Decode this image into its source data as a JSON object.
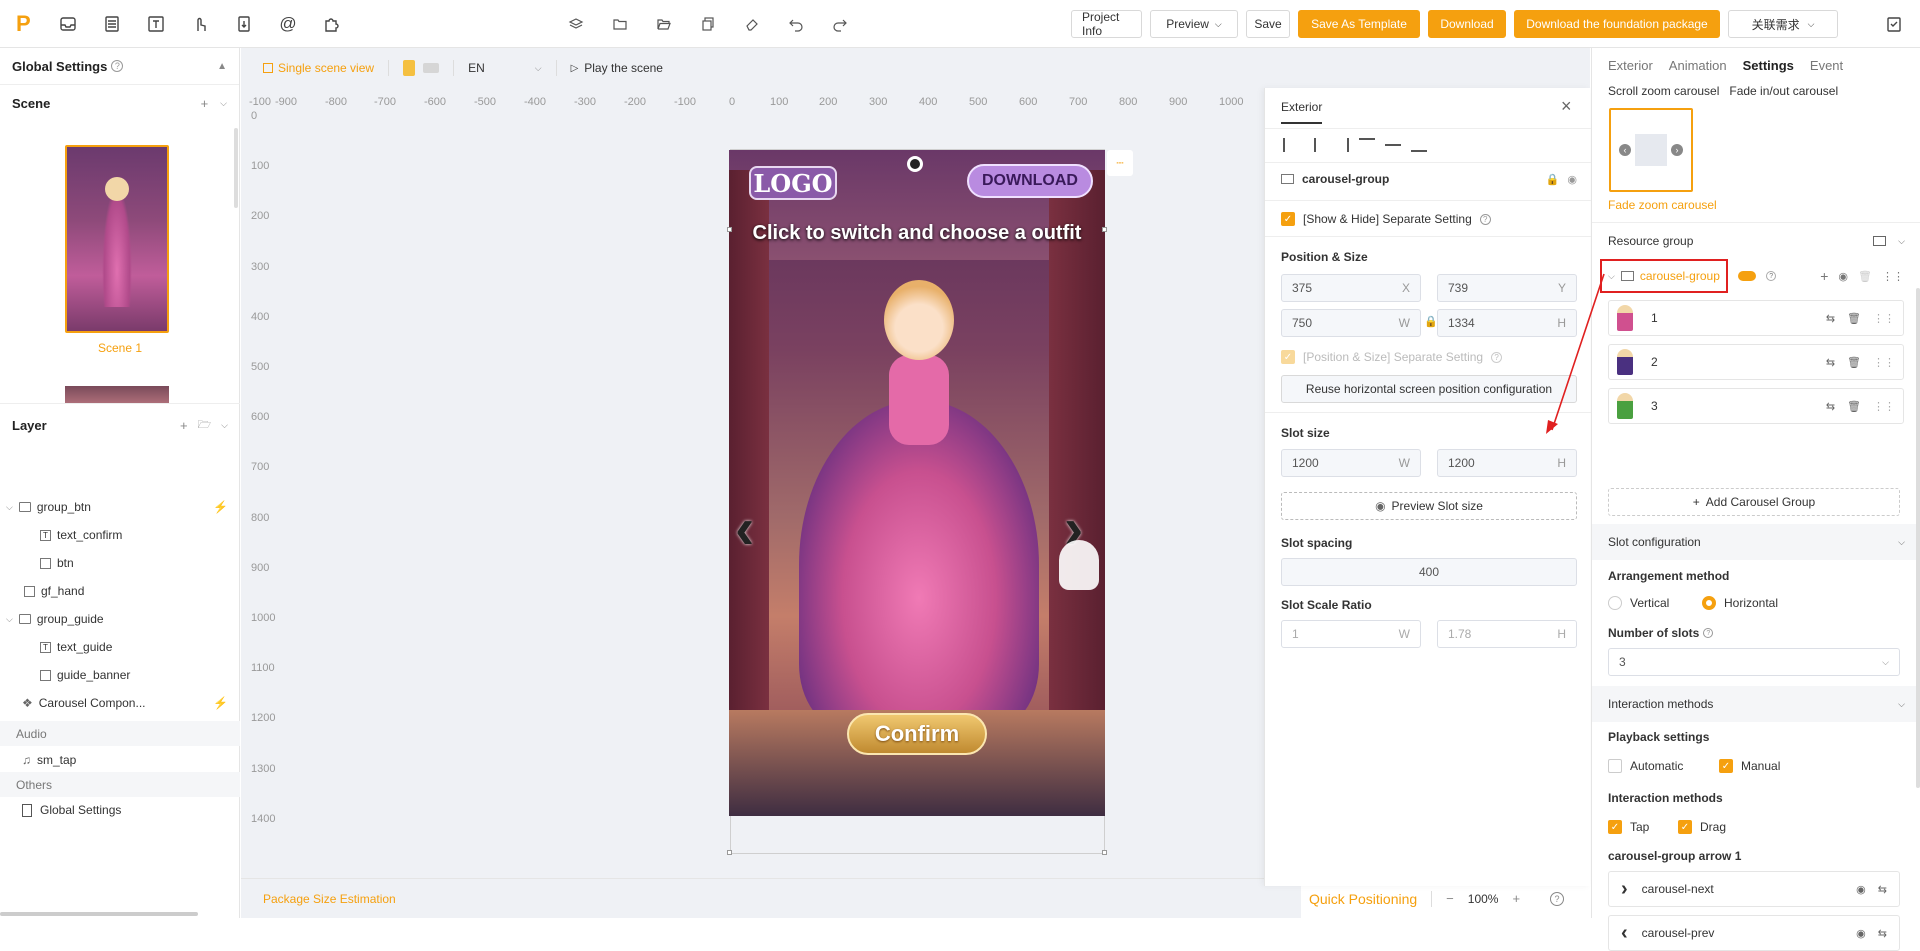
{
  "app": {
    "logo": "P"
  },
  "toolbar": {
    "project_info": "Project Info",
    "preview": "Preview",
    "save": "Save",
    "save_as_template": "Save As Template",
    "download": "Download",
    "download_foundation": "Download the foundation package",
    "related_needs": "关联需求"
  },
  "left": {
    "global_settings": "Global Settings",
    "scene_title": "Scene",
    "scene1": "Scene 1",
    "layer_title": "Layer",
    "layers": [
      {
        "label": "group_btn"
      },
      {
        "label": "text_confirm"
      },
      {
        "label": "btn"
      },
      {
        "label": "gf_hand"
      },
      {
        "label": "group_guide"
      },
      {
        "label": "text_guide"
      },
      {
        "label": "guide_banner"
      },
      {
        "label": "Carousel Compon..."
      }
    ],
    "audio_title": "Audio",
    "audio_item": "sm_tap",
    "others_title": "Others",
    "others_item": "Global Settings"
  },
  "canvas": {
    "single_scene_view": "Single scene view",
    "language": "EN",
    "play_scene": "Play the scene",
    "ruler_x": [
      "-100",
      "-900",
      "-800",
      "-700",
      "-600",
      "-500",
      "-400",
      "-300",
      "-200",
      "-100",
      "0",
      "100",
      "200",
      "300",
      "400",
      "500",
      "600",
      "700",
      "800",
      "900",
      "1000"
    ],
    "ruler_y": [
      "0",
      "100",
      "200",
      "300",
      "400",
      "500",
      "600",
      "700",
      "800",
      "900",
      "1000",
      "1100",
      "1200",
      "1300",
      "1400"
    ],
    "phone": {
      "logo": "LOGO",
      "download": "DOWNLOAD",
      "headline": "Click to switch and choose a outfit",
      "confirm": "Confirm"
    },
    "package_size": "Package Size Estimation",
    "quick_positioning": "Quick Positioning",
    "zoom": "100%"
  },
  "exterior": {
    "title": "Exterior",
    "group_name": "carousel-group",
    "show_hide": "[Show & Hide] Separate Setting",
    "position_size": "Position & Size",
    "x": "375",
    "x_unit": "X",
    "y": "739",
    "y_unit": "Y",
    "w": "750",
    "w_unit": "W",
    "h": "1334",
    "h_unit": "H",
    "pos_separate": "[Position & Size] Separate Setting",
    "reuse_btn": "Reuse horizontal screen position configuration",
    "slot_size": "Slot size",
    "slot_w": "1200",
    "slot_h": "1200",
    "preview_slot": "Preview Slot size",
    "slot_spacing": "Slot spacing",
    "spacing_val": "400",
    "scale_ratio": "Slot Scale Ratio",
    "ratio_w": "1",
    "ratio_h": "1.78"
  },
  "right": {
    "tabs": [
      "Exterior",
      "Animation",
      "Settings",
      "Event"
    ],
    "active_tab": "Settings",
    "carousel_types": [
      "Scroll zoom carousel",
      "Fade in/out carousel"
    ],
    "selected_type": "Fade zoom carousel",
    "resource_group": "Resource group",
    "group_name": "carousel-group",
    "items": [
      "1",
      "2",
      "3"
    ],
    "add_group": "Add Carousel Group",
    "slot_config": "Slot configuration",
    "arrangement": "Arrangement method",
    "vertical": "Vertical",
    "horizontal": "Horizontal",
    "num_slots": "Number of slots",
    "num_slots_val": "3",
    "interaction_methods_hdr": "Interaction methods",
    "playback": "Playback settings",
    "automatic": "Automatic",
    "manual": "Manual",
    "interaction_methods": "Interaction methods",
    "tap": "Tap",
    "drag": "Drag",
    "arrow_title": "carousel-group arrow 1",
    "arrow_next": "carousel-next",
    "arrow_prev": "carousel-prev"
  },
  "colors": {
    "accent": "#f5a00f",
    "highlight": "#e02020"
  }
}
